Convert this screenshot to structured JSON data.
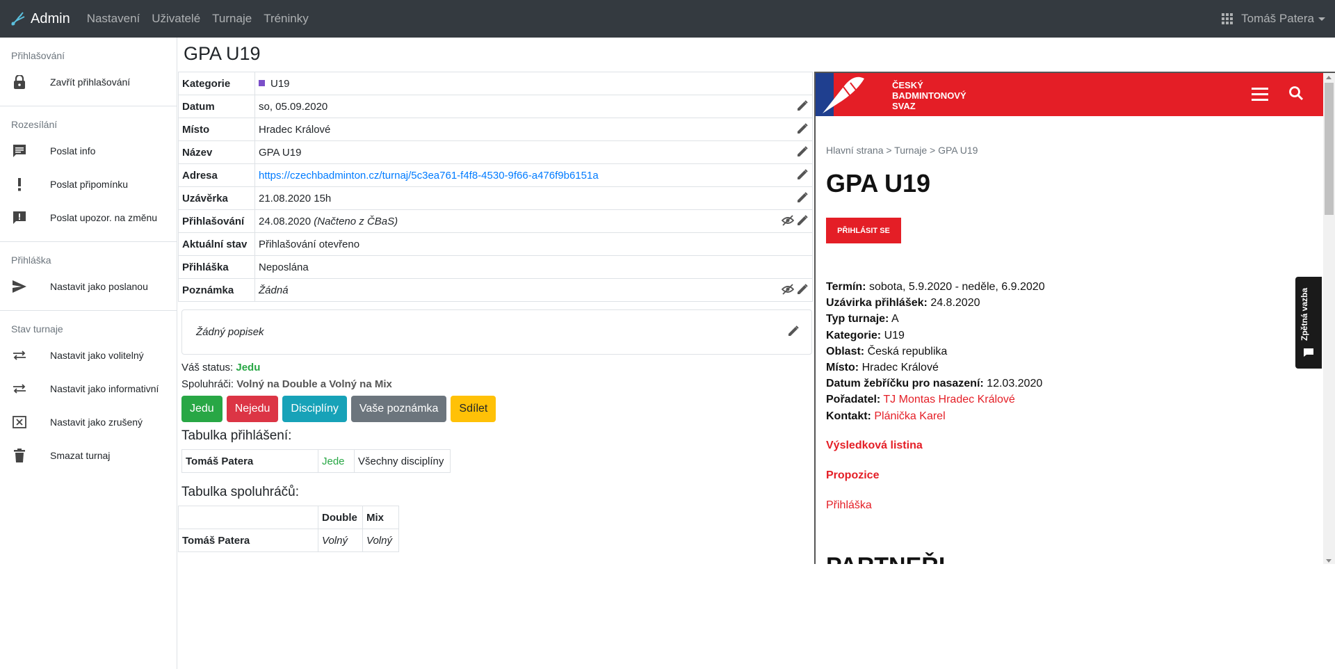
{
  "navbar": {
    "brand": "Admin",
    "links": [
      "Nastavení",
      "Uživatelé",
      "Turnaje",
      "Tréninky"
    ],
    "user": "Tomáš Patera"
  },
  "sidebar": {
    "sections": [
      {
        "title": "Přihlašování",
        "items": [
          {
            "label": "Zavřít přihlašování",
            "icon": "lock-icon"
          }
        ]
      },
      {
        "title": "Rozesílání",
        "items": [
          {
            "label": "Poslat info",
            "icon": "message-icon"
          },
          {
            "label": "Poslat připomínku",
            "icon": "exclamation-icon"
          },
          {
            "label": "Poslat upozor. na změnu",
            "icon": "alert-message-icon"
          }
        ]
      },
      {
        "title": "Přihláška",
        "items": [
          {
            "label": "Nastavit jako poslanou",
            "icon": "send-icon"
          }
        ]
      },
      {
        "title": "Stav turnaje",
        "items": [
          {
            "label": "Nastavit jako volitelný",
            "icon": "swap-icon"
          },
          {
            "label": "Nastavit jako informativní",
            "icon": "swap-icon"
          },
          {
            "label": "Nastavit jako zrušený",
            "icon": "cancel-box-icon"
          },
          {
            "label": "Smazat turnaj",
            "icon": "trash-icon"
          }
        ]
      }
    ]
  },
  "main": {
    "title": "GPA U19",
    "info": {
      "kategorie_label": "Kategorie",
      "kategorie_value": "U19",
      "datum_label": "Datum",
      "datum_value": "so, 05.09.2020",
      "misto_label": "Místo",
      "misto_value": "Hradec Králové",
      "nazev_label": "Název",
      "nazev_value": "GPA U19",
      "adresa_label": "Adresa",
      "adresa_value": "https://czechbadminton.cz/turnaj/5c3ea761-f4f8-4530-9f66-a476f9b6151a",
      "uzaverka_label": "Uzávěrka",
      "uzaverka_value": "21.08.2020 15h",
      "prihlasovani_label": "Přihlašování",
      "prihlasovani_value": "24.08.2020",
      "prihlasovani_note": "(Načteno z ČBaS)",
      "stav_label": "Aktuální stav",
      "stav_value": "Přihlašování otevřeno",
      "prihlaska_label": "Přihláška",
      "prihlaska_value": "Neposlána",
      "poznamka_label": "Poznámka",
      "poznamka_value": "Žádná"
    },
    "description": "Žádný popisek",
    "status": {
      "label": "Váš status:",
      "value": "Jedu"
    },
    "partners": {
      "label": "Spoluhráči:",
      "value": "Volný na Double a Volný na Mix"
    },
    "buttons": {
      "jedu": "Jedu",
      "nejedu": "Nejedu",
      "discipliny": "Disciplíny",
      "poznamka": "Vaše poznámka",
      "sdilet": "Sdílet"
    },
    "reg_title": "Tabulka přihlášení:",
    "reg_rows": [
      {
        "name": "Tomáš Patera",
        "status": "Jede",
        "disc": "Všechny disciplíny"
      }
    ],
    "part_title": "Tabulka spoluhráčů:",
    "part_headers": [
      "",
      "Double",
      "Mix"
    ],
    "part_rows": [
      {
        "name": "Tomáš Patera",
        "double": "Volný",
        "mix": "Volný"
      }
    ]
  },
  "embed": {
    "logo_line1": "ČESKÝ",
    "logo_line2": "BADMINTONOVÝ",
    "logo_line3": "SVAZ",
    "breadcrumb": "Hlavní strana > Turnaje > GPA U19",
    "title": "GPA U19",
    "signup_btn": "PŘIHLÁSIT SE",
    "termin_label": "Termín:",
    "termin_value": "sobota, 5.9.2020 - neděle, 6.9.2020",
    "uzavirka_label": "Uzávirka přihlášek:",
    "uzavirka_value": "24.8.2020",
    "typ_label": "Typ turnaje:",
    "typ_value": "A",
    "kategorie_label": "Kategorie:",
    "kategorie_value": "U19",
    "oblast_label": "Oblast:",
    "oblast_value": "Česká republika",
    "misto_label": "Místo:",
    "misto_value": "Hradec Králové",
    "zebricek_label": "Datum žebříčku pro nasazení:",
    "zebricek_value": "12.03.2020",
    "poradatel_label": "Pořadatel:",
    "poradatel_value": "TJ Montas Hradec Králové",
    "kontakt_label": "Kontakt:",
    "kontakt_value": "Plánička Karel",
    "vysledky": "Výsledková listina",
    "propozice": "Propozice",
    "prihlaska": "Přihláška",
    "partneri": "PARTNEŘI",
    "feedback": "Zpětná vazba"
  },
  "colors": {
    "navbar": "#343a40",
    "primary_link": "#007bff",
    "cbs_red": "#e41e26",
    "success": "#28a745",
    "danger": "#dc3545",
    "info": "#17a2b8",
    "secondary": "#6c757d",
    "warning": "#ffc107"
  }
}
